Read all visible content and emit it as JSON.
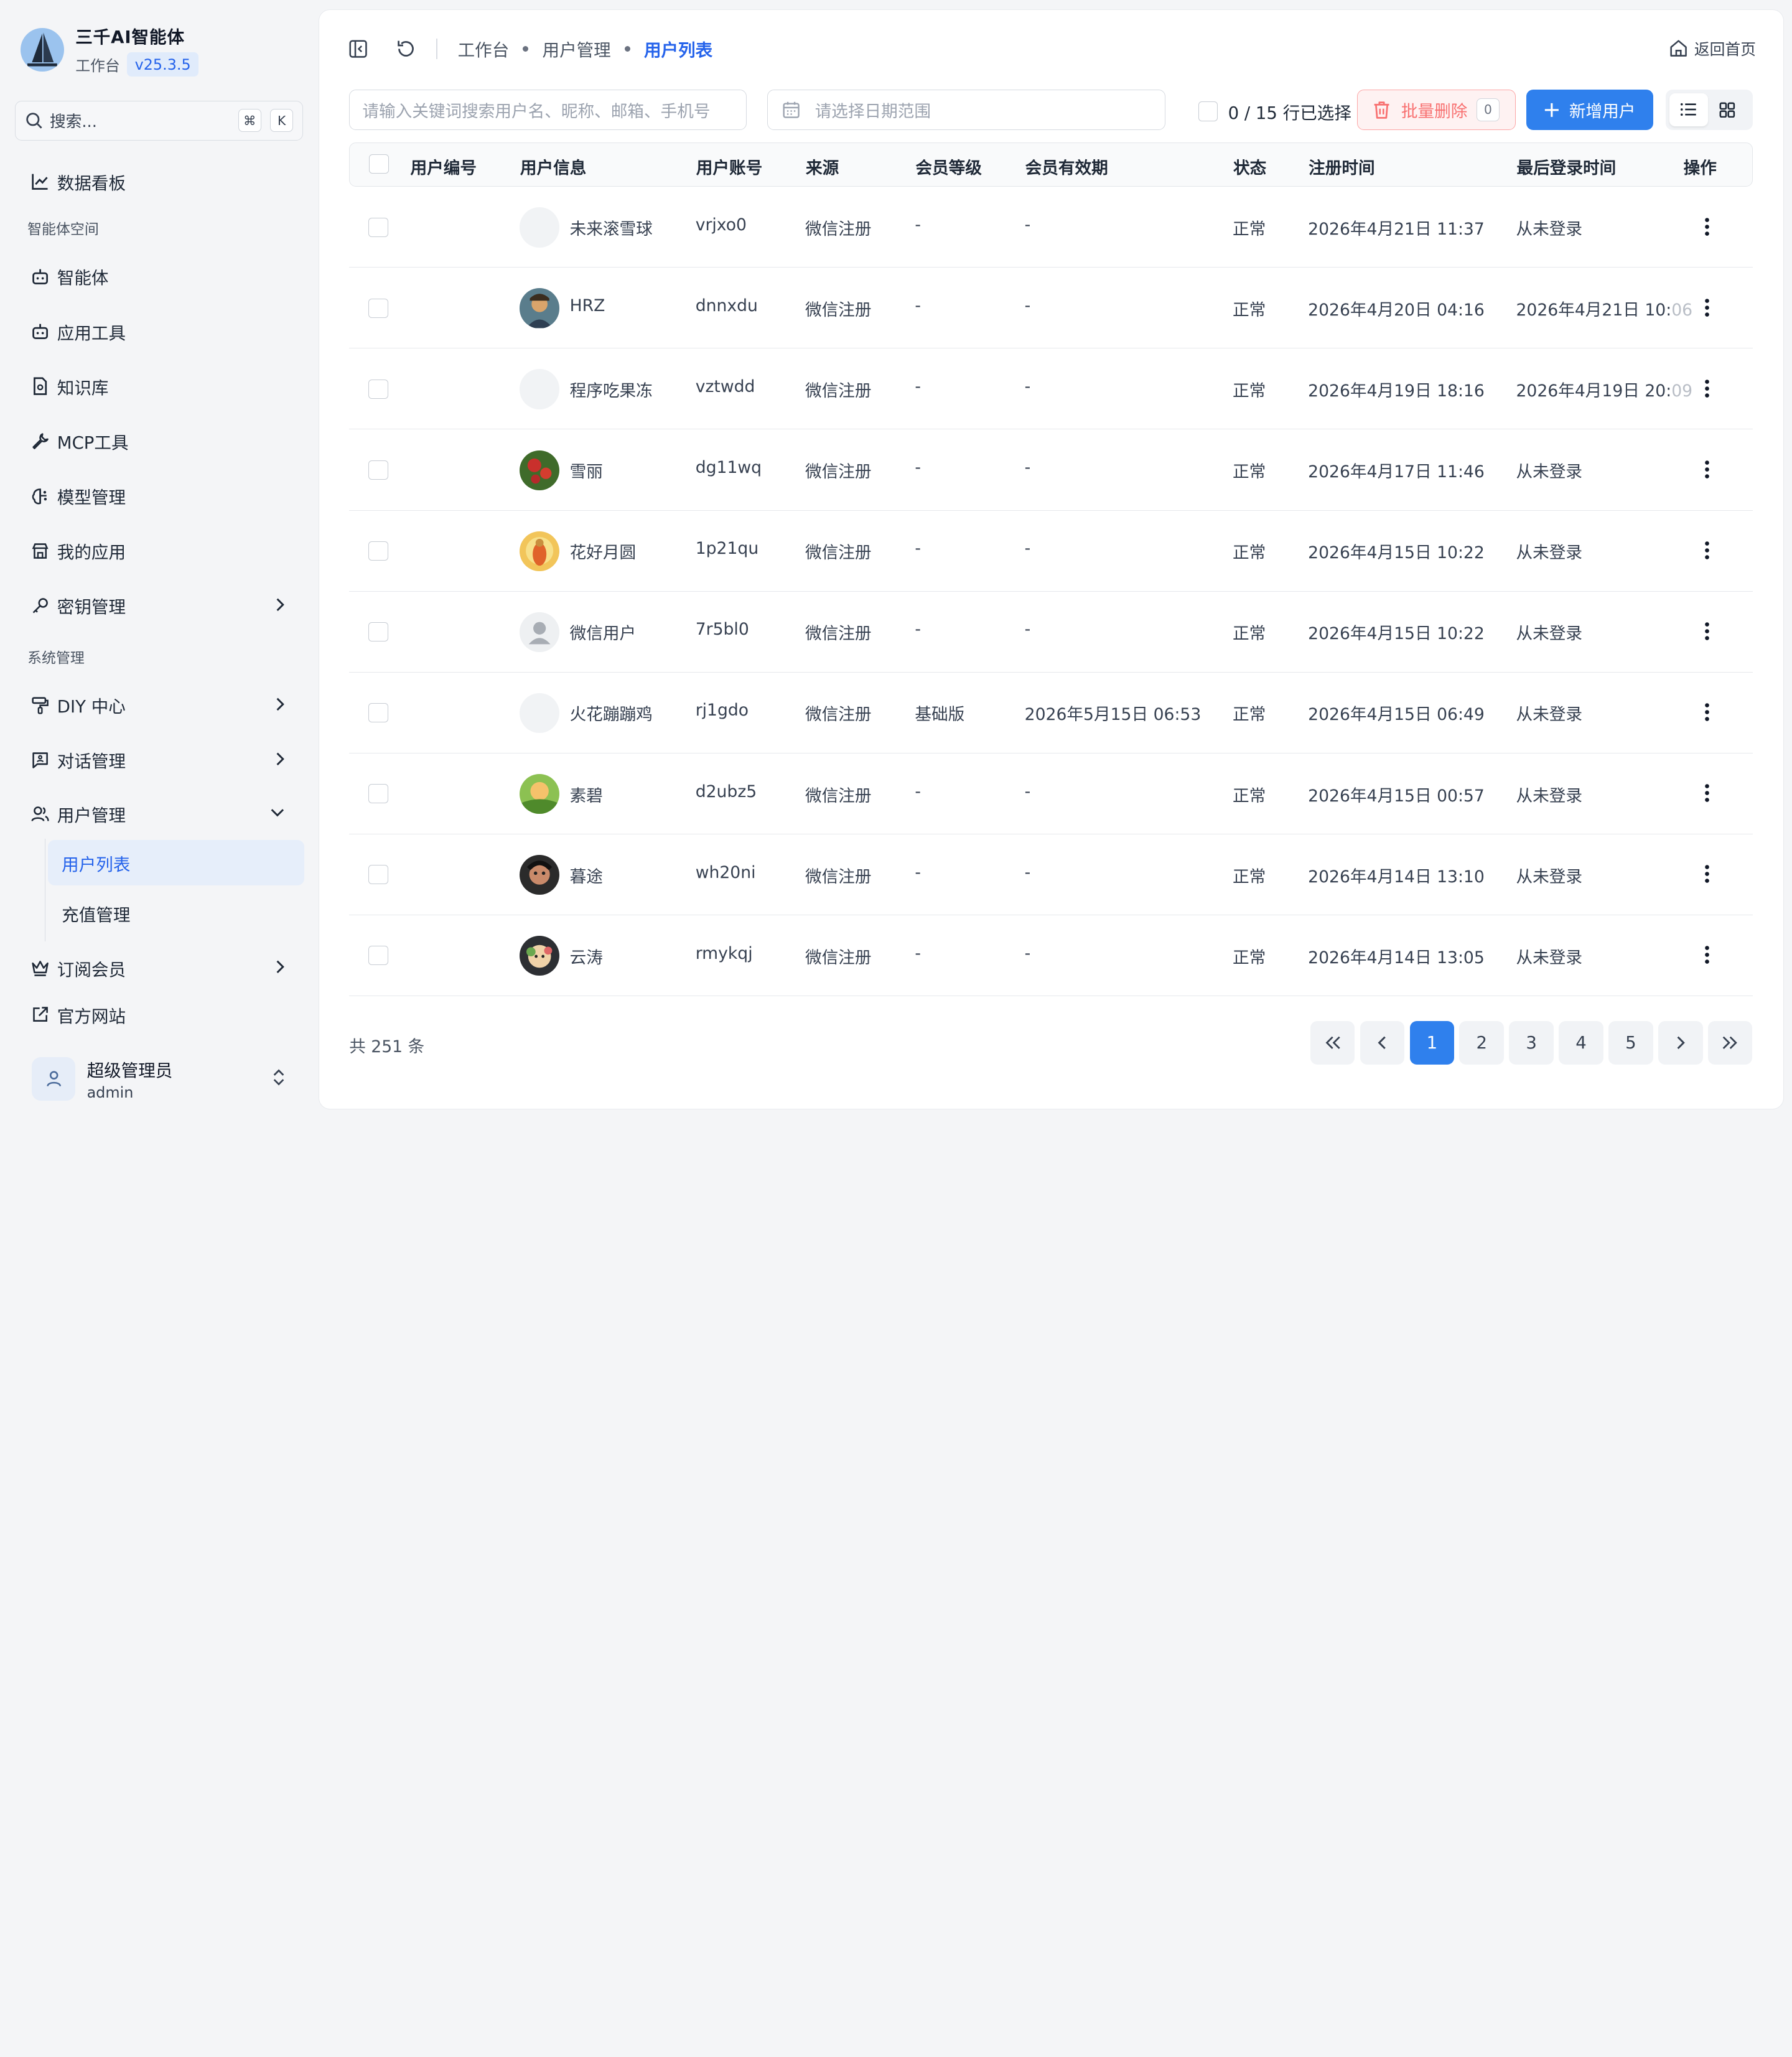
{
  "brand": {
    "name": "三千AI智能体",
    "workspace_label": "工作台",
    "version": "v25.3.5"
  },
  "sidebar": {
    "search_label": "搜索...",
    "shortcut_keys": [
      "⌘",
      "K"
    ],
    "items": [
      {
        "label": "数据看板",
        "icon": "chart-line-icon"
      },
      {
        "section": "智能体空间"
      },
      {
        "label": "智能体",
        "icon": "bot-icon"
      },
      {
        "label": "应用工具",
        "icon": "bot-icon"
      },
      {
        "label": "知识库",
        "icon": "document-icon"
      },
      {
        "label": "MCP工具",
        "icon": "wrench-icon"
      },
      {
        "label": "模型管理",
        "icon": "brain-icon"
      },
      {
        "label": "我的应用",
        "icon": "store-icon"
      },
      {
        "label": "密钥管理",
        "icon": "key-icon"
      },
      {
        "section": "系统管理"
      },
      {
        "label": "DIY 中心",
        "icon": "paint-roller-icon"
      },
      {
        "label": "对话管理",
        "icon": "chat-icon"
      },
      {
        "label": "用户管理",
        "icon": "users-icon"
      },
      {
        "label": "用户列表"
      },
      {
        "label": "充值管理"
      },
      {
        "label": "订阅会员",
        "icon": "crown-icon"
      },
      {
        "label": "官方网站",
        "icon": "external-link-icon"
      }
    ]
  },
  "user": {
    "name": "超级管理员",
    "account": "admin"
  },
  "breadcrumb": [
    "工作台",
    "用户管理",
    "用户列表"
  ],
  "back_home_label": "返回首页",
  "toolbar": {
    "keyword_placeholder": "请输入关键词搜索用户名、昵称、邮箱、手机号",
    "date_placeholder": "请选择日期范围",
    "selection_text": "0 / 15 行已选择",
    "batch_delete_label": "批量删除",
    "batch_delete_count": "0",
    "add_user_label": "新增用户"
  },
  "table": {
    "columns": [
      "用户编号",
      "用户信息",
      "用户账号",
      "来源",
      "会员等级",
      "会员有效期",
      "状态",
      "注册时间",
      "最后登录时间",
      "操作"
    ],
    "rows": [
      {
        "name": "未来滚雪球",
        "account": "vrjxo0",
        "source": "微信注册",
        "level": "-",
        "expire": "-",
        "status": "正常",
        "registered": "2026年4月21日 11:37",
        "last_login": "从未登录",
        "last_login_tail": "",
        "avatar": "blank"
      },
      {
        "name": "HRZ",
        "account": "dnnxdu",
        "source": "微信注册",
        "level": "-",
        "expire": "-",
        "status": "正常",
        "registered": "2026年4月20日 04:16",
        "last_login": "2026年4月21日 10:",
        "last_login_tail": "06",
        "avatar": "portrait"
      },
      {
        "name": "程序吃果冻",
        "account": "vztwdd",
        "source": "微信注册",
        "level": "-",
        "expire": "-",
        "status": "正常",
        "registered": "2026年4月19日 18:16",
        "last_login": "2026年4月19日 20:",
        "last_login_tail": "09",
        "avatar": "blank"
      },
      {
        "name": "雪丽",
        "account": "dg11wq",
        "source": "微信注册",
        "level": "-",
        "expire": "-",
        "status": "正常",
        "registered": "2026年4月17日 11:46",
        "last_login": "从未登录",
        "last_login_tail": "",
        "avatar": "flower"
      },
      {
        "name": "花好月圆",
        "account": "1p21qu",
        "source": "微信注册",
        "level": "-",
        "expire": "-",
        "status": "正常",
        "registered": "2026年4月15日 10:22",
        "last_login": "从未登录",
        "last_login_tail": "",
        "avatar": "buddha"
      },
      {
        "name": "微信用户",
        "account": "7r5bl0",
        "source": "微信注册",
        "level": "-",
        "expire": "-",
        "status": "正常",
        "registered": "2026年4月15日 10:22",
        "last_login": "从未登录",
        "last_login_tail": "",
        "avatar": "default"
      },
      {
        "name": "火花蹦蹦鸡",
        "account": "rj1gdo",
        "source": "微信注册",
        "level": "基础版",
        "expire": "2026年5月15日 06:53",
        "status": "正常",
        "registered": "2026年4月15日 06:49",
        "last_login": "从未登录",
        "last_login_tail": "",
        "avatar": "blank"
      },
      {
        "name": "素碧",
        "account": "d2ubz5",
        "source": "微信注册",
        "level": "-",
        "expire": "-",
        "status": "正常",
        "registered": "2026年4月15日 00:57",
        "last_login": "从未登录",
        "last_login_tail": "",
        "avatar": "landscape"
      },
      {
        "name": "暮途",
        "account": "wh20ni",
        "source": "微信注册",
        "level": "-",
        "expire": "-",
        "status": "正常",
        "registered": "2026年4月14日 13:10",
        "last_login": "从未登录",
        "last_login_tail": "",
        "avatar": "dark"
      },
      {
        "name": "云涛",
        "account": "rmykqj",
        "source": "微信注册",
        "level": "-",
        "expire": "-",
        "status": "正常",
        "registered": "2026年4月14日 13:05",
        "last_login": "从未登录",
        "last_login_tail": "",
        "avatar": "cartoon"
      }
    ]
  },
  "pagination": {
    "total_text": "共 251 条",
    "pages": [
      "1",
      "2",
      "3",
      "4",
      "5"
    ],
    "current": "1"
  },
  "colors": {
    "accent": "#2f80ed",
    "danger": "#f87171",
    "active_bg": "#e6eefa"
  }
}
